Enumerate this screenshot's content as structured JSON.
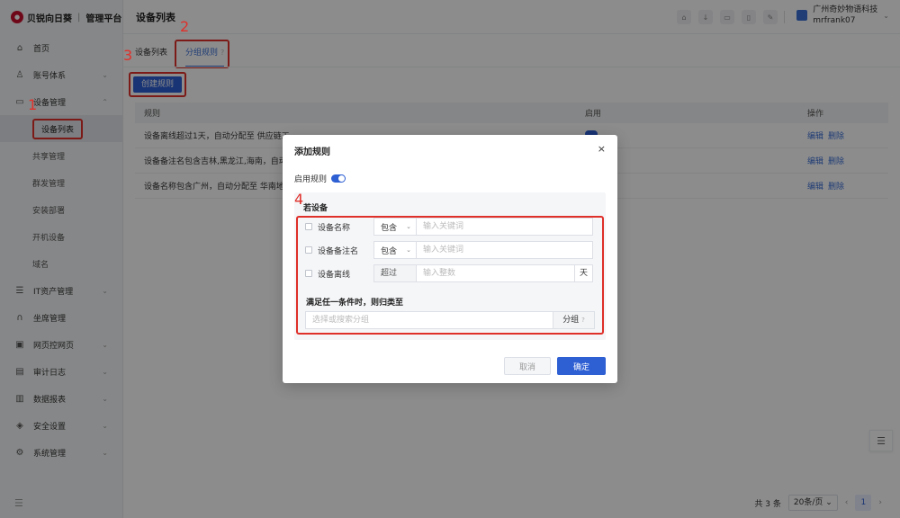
{
  "brand": {
    "name": "贝锐向日葵",
    "platform": "管理平台"
  },
  "header": {
    "title": "设备列表",
    "org": "广州奇妙物语科技",
    "user": "mrfrank07",
    "icons": [
      "home-icon",
      "download-icon",
      "message-icon",
      "delete-icon",
      "edit-icon"
    ]
  },
  "sidebar": {
    "items": [
      {
        "label": "首页",
        "icon": "home-icon"
      },
      {
        "label": "账号体系",
        "icon": "user-icon",
        "caret": "⌄"
      },
      {
        "label": "设备管理",
        "icon": "monitor-icon",
        "caret": "⌃"
      }
    ],
    "sub_items": [
      "设备列表",
      "共享管理",
      "群发管理",
      "安装部署",
      "开机设备",
      "域名"
    ],
    "items_bottom": [
      {
        "label": "IT资产管理",
        "icon": "server-icon",
        "caret": "⌄"
      },
      {
        "label": "坐席管理",
        "icon": "headset-icon",
        "caret": ""
      },
      {
        "label": "网页控网页",
        "icon": "browser-icon",
        "caret": "⌄"
      },
      {
        "label": "审计日志",
        "icon": "log-icon",
        "caret": "⌄"
      },
      {
        "label": "数据报表",
        "icon": "chart-icon",
        "caret": "⌄"
      },
      {
        "label": "安全设置",
        "icon": "shield-icon",
        "caret": "⌄"
      },
      {
        "label": "系统管理",
        "icon": "gear-icon",
        "caret": "⌄"
      }
    ],
    "footer_icon": "collapse-icon"
  },
  "annotations": {
    "n1": "1",
    "n2": "2",
    "n3": "3",
    "n4": "4"
  },
  "tabs": [
    {
      "label": "设备列表"
    },
    {
      "label": "分组规则"
    }
  ],
  "toolbar": {
    "create_label": "创建规则"
  },
  "table": {
    "headers": [
      "规则",
      "启用",
      "操作"
    ],
    "rows": [
      {
        "rule": "设备离线超过1天，自动分配至 供应链工"
      },
      {
        "rule": "设备备注名包含吉林,黑龙江,海南，自动"
      },
      {
        "rule": "设备名称包含广州，自动分配至 华南地区"
      }
    ],
    "actions": {
      "edit": "编辑",
      "delete": "删除"
    }
  },
  "pagination": {
    "total": "共 3 条",
    "page_size": "20条/页 ⌄",
    "current": "1",
    "prev": "‹",
    "next": "›"
  },
  "modal": {
    "title": "添加规则",
    "close": "×",
    "enable_label": "启用规则",
    "enabled": true,
    "condition_title": "若设备",
    "conditions": [
      {
        "label": "设备名称",
        "op": "包含",
        "placeholder": "输入关键词"
      },
      {
        "label": "设备备注名",
        "op": "包含",
        "placeholder": "输入关键词"
      },
      {
        "label": "设备离线",
        "op": "超过",
        "placeholder": "输入整数",
        "suffix": "天"
      }
    ],
    "match_label": "满足任一条件时，则归类至",
    "group_placeholder": "选择或搜索分组",
    "group_button": "分组",
    "cancel": "取消",
    "ok": "确定"
  },
  "colors": {
    "primary": "#2e5fd3",
    "annotation": "#e0302a"
  }
}
